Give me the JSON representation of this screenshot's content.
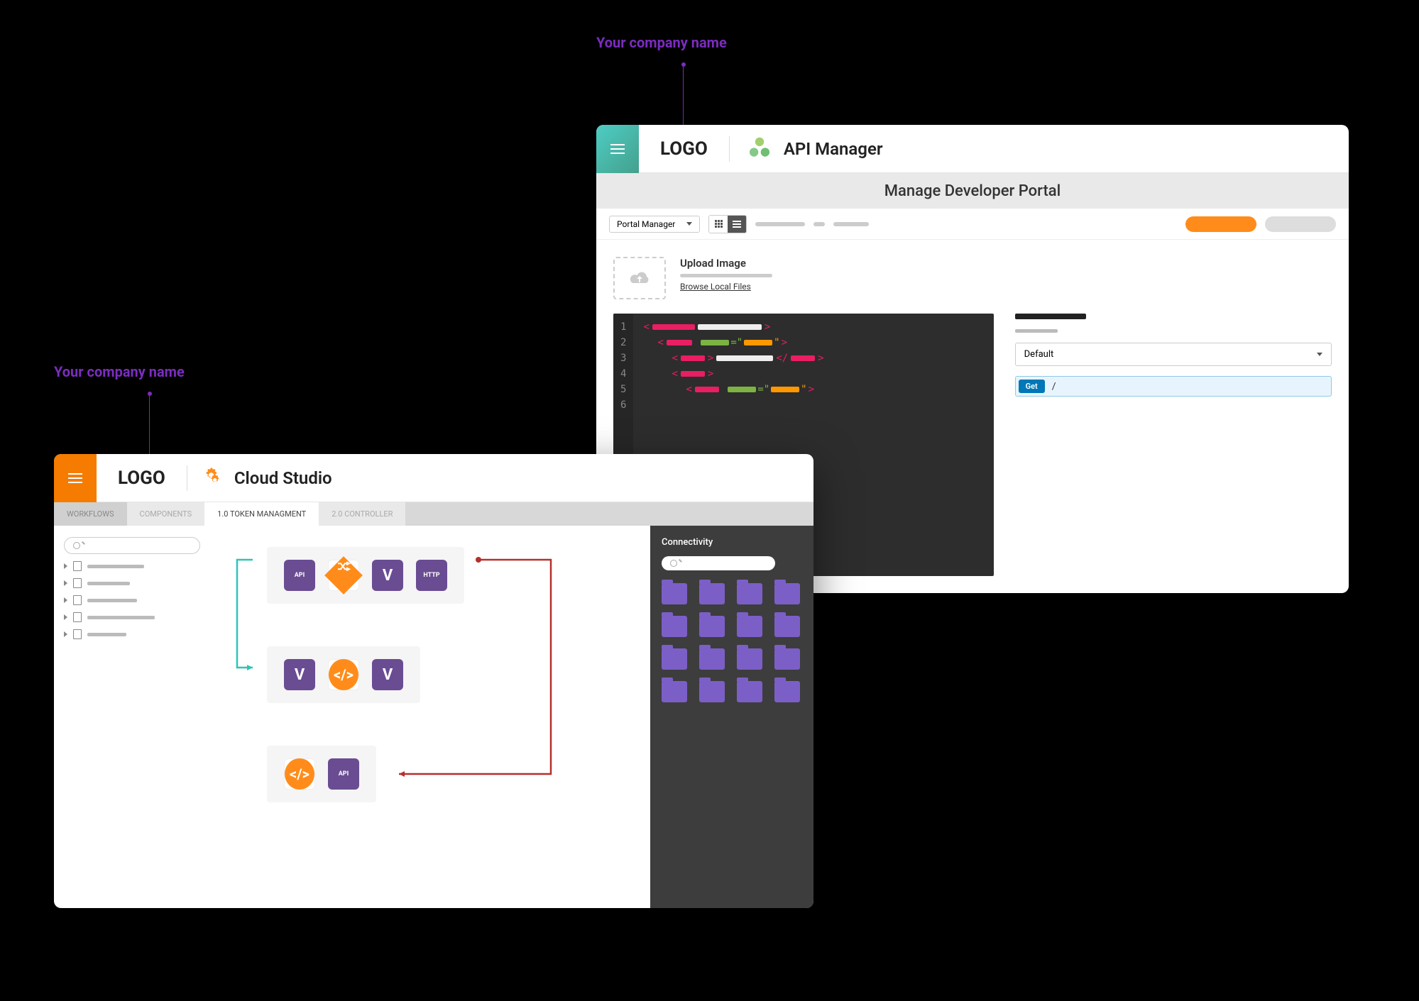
{
  "callouts": {
    "api": "Your company name",
    "cs": "Your company name"
  },
  "api_window": {
    "logo": "LOGO",
    "app_name": "API Manager",
    "subheader": "Manage Developer Portal",
    "toolbar": {
      "dropdown_label": "Portal Manager"
    },
    "upload": {
      "title": "Upload Image",
      "browse": "Browse Local Files"
    },
    "code_lines": [
      "1",
      "2",
      "3",
      "4",
      "5",
      "6"
    ],
    "right_col": {
      "select_value": "Default",
      "method": "Get",
      "path": "/"
    }
  },
  "cs_window": {
    "logo": "LOGO",
    "app_name": "Cloud Studio",
    "tabs": {
      "workflows": "WORKFLOWS",
      "components": "COMPONENTS",
      "token": "1.0 TOKEN MANAGMENT",
      "controller": "2.0 CONTROLLER"
    },
    "nodes": {
      "api": "API",
      "http": "HTTP"
    },
    "right": {
      "title": "Connectivity"
    }
  }
}
